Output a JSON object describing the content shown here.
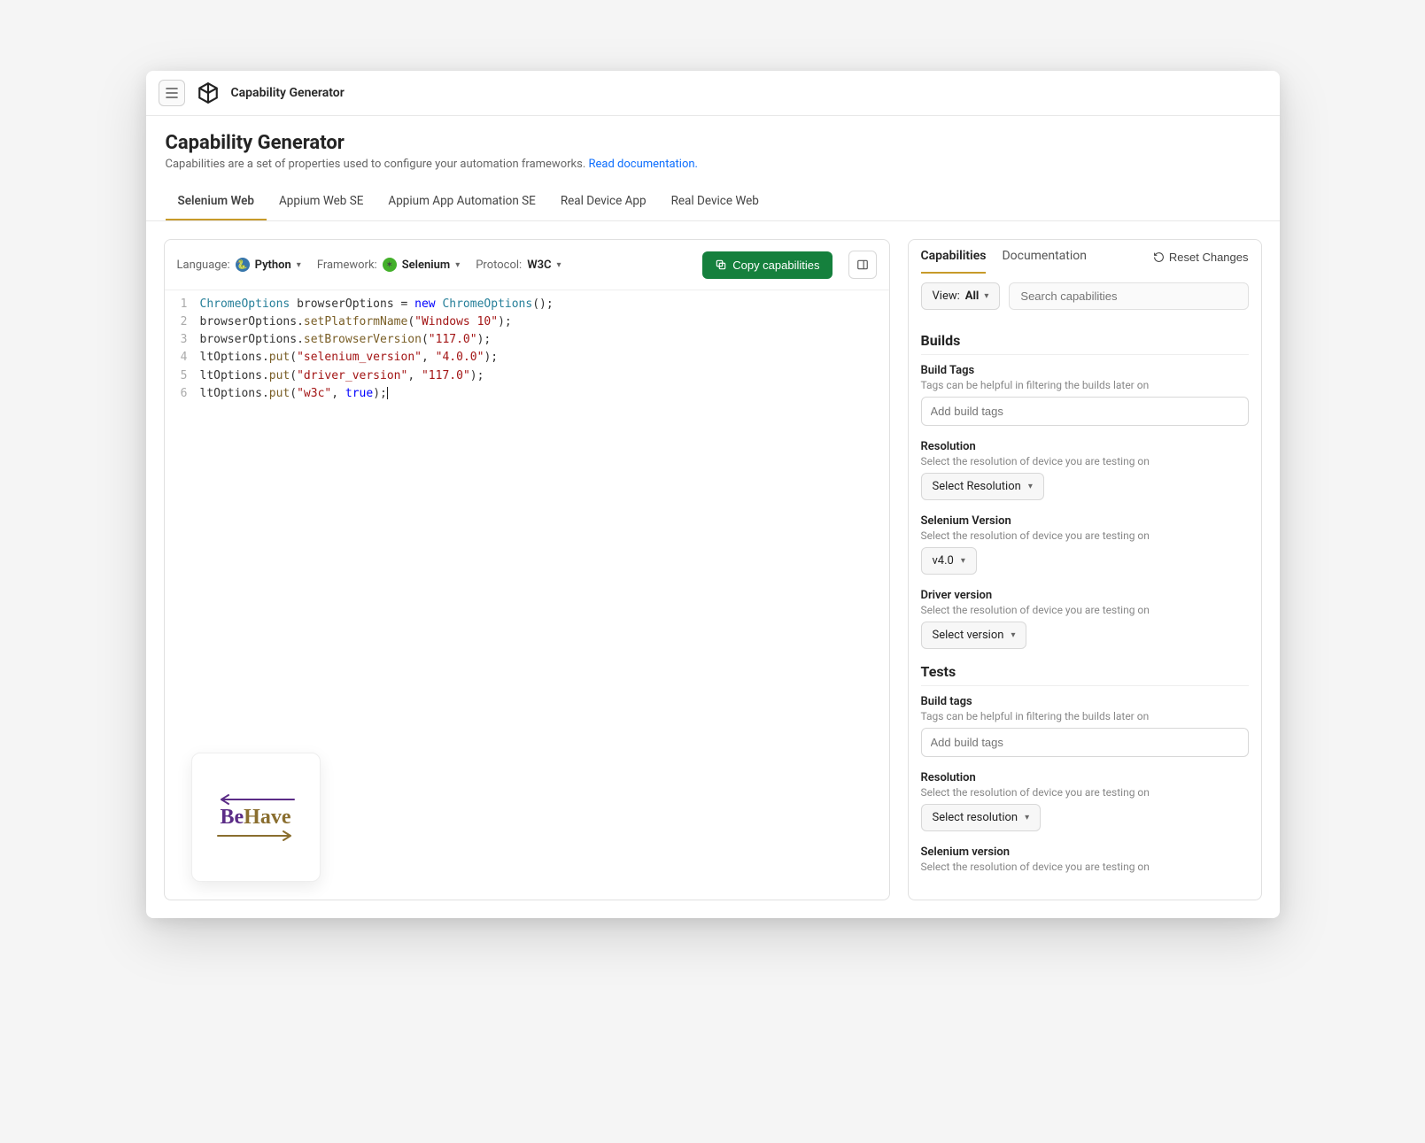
{
  "app": {
    "title": "Capability Generator"
  },
  "header": {
    "title": "Capability Generator",
    "subtitle": "Capabilities are a set of properties used to configure your automation frameworks. ",
    "doc_link": "Read documentation."
  },
  "main_tabs": [
    {
      "label": "Selenium Web",
      "active": true
    },
    {
      "label": "Appium Web SE",
      "active": false
    },
    {
      "label": "Appium App Automation SE",
      "active": false
    },
    {
      "label": "Real Device App",
      "active": false
    },
    {
      "label": "Real Device Web",
      "active": false
    }
  ],
  "code_toolbar": {
    "language_label": "Language:",
    "language_value": "Python",
    "framework_label": "Framework:",
    "framework_value": "Selenium",
    "protocol_label": "Protocol:",
    "protocol_value": "W3C",
    "copy_label": "Copy capabilities"
  },
  "code": {
    "lines": [
      {
        "n": "1",
        "tokens": [
          {
            "t": "type",
            "v": "ChromeOptions"
          },
          {
            "t": "plain",
            "v": " browserOptions "
          },
          {
            "t": "plain",
            "v": "= "
          },
          {
            "t": "kw",
            "v": "new"
          },
          {
            "t": "plain",
            "v": " "
          },
          {
            "t": "type",
            "v": "ChromeOptions"
          },
          {
            "t": "plain",
            "v": "();"
          }
        ]
      },
      {
        "n": "2",
        "tokens": [
          {
            "t": "plain",
            "v": "browserOptions."
          },
          {
            "t": "method",
            "v": "setPlatformName"
          },
          {
            "t": "plain",
            "v": "("
          },
          {
            "t": "str",
            "v": "\"Windows 10\""
          },
          {
            "t": "plain",
            "v": ");"
          }
        ]
      },
      {
        "n": "3",
        "tokens": [
          {
            "t": "plain",
            "v": "browserOptions."
          },
          {
            "t": "method",
            "v": "setBrowserVersion"
          },
          {
            "t": "plain",
            "v": "("
          },
          {
            "t": "str",
            "v": "\"117.0\""
          },
          {
            "t": "plain",
            "v": ");"
          }
        ]
      },
      {
        "n": "4",
        "tokens": [
          {
            "t": "plain",
            "v": "ltOptions."
          },
          {
            "t": "method",
            "v": "put"
          },
          {
            "t": "plain",
            "v": "("
          },
          {
            "t": "str",
            "v": "\"selenium_version\""
          },
          {
            "t": "plain",
            "v": ", "
          },
          {
            "t": "str",
            "v": "\"4.0.0\""
          },
          {
            "t": "plain",
            "v": ");"
          }
        ]
      },
      {
        "n": "5",
        "tokens": [
          {
            "t": "plain",
            "v": "ltOptions."
          },
          {
            "t": "method",
            "v": "put"
          },
          {
            "t": "plain",
            "v": "("
          },
          {
            "t": "str",
            "v": "\"driver_version\""
          },
          {
            "t": "plain",
            "v": ", "
          },
          {
            "t": "str",
            "v": "\"117.0\""
          },
          {
            "t": "plain",
            "v": ");"
          }
        ]
      },
      {
        "n": "6",
        "tokens": [
          {
            "t": "plain",
            "v": "ltOptions."
          },
          {
            "t": "method",
            "v": "put"
          },
          {
            "t": "plain",
            "v": "("
          },
          {
            "t": "str",
            "v": "\"w3c\""
          },
          {
            "t": "plain",
            "v": ", "
          },
          {
            "t": "bool",
            "v": "true"
          },
          {
            "t": "plain",
            "v": ");"
          }
        ]
      }
    ]
  },
  "badge": {
    "text_left": "Be",
    "text_right": "Have"
  },
  "right": {
    "tabs": [
      {
        "label": "Capabilities",
        "active": true
      },
      {
        "label": "Documentation",
        "active": false
      }
    ],
    "reset_label": "Reset Changes",
    "view_label": "View:",
    "view_value": "All",
    "search_placeholder": "Search capabilities",
    "sections": [
      {
        "title": "Builds",
        "fields": [
          {
            "kind": "text",
            "label": "Build Tags",
            "help": "Tags can be helpful in filtering the builds later on",
            "placeholder": "Add build tags"
          },
          {
            "kind": "dropdown",
            "label": "Resolution",
            "help": "Select the resolution of device you are testing on",
            "value": "Select Resolution"
          },
          {
            "kind": "dropdown",
            "label": "Selenium Version",
            "help": "Select the resolution of device you are testing on",
            "value": "v4.0"
          },
          {
            "kind": "dropdown",
            "label": "Driver version",
            "help": "Select the resolution of device you are testing on",
            "value": "Select version"
          }
        ]
      },
      {
        "title": "Tests",
        "fields": [
          {
            "kind": "text",
            "label": "Build tags",
            "help": "Tags can be helpful in filtering the builds later on",
            "placeholder": "Add build tags"
          },
          {
            "kind": "dropdown",
            "label": "Resolution",
            "help": "Select the resolution of device you are testing on",
            "value": "Select resolution"
          },
          {
            "kind": "dropdown",
            "label": "Selenium version",
            "help": "Select the resolution of device you are testing on",
            "value": ""
          }
        ]
      }
    ]
  }
}
